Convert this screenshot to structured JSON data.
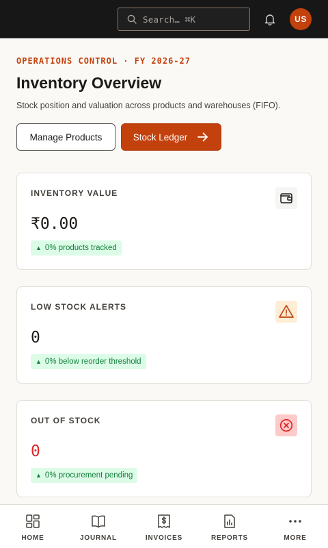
{
  "header": {
    "search_placeholder": "Search… ⌘K",
    "avatar_initials": "US"
  },
  "page": {
    "eyebrow": "OPERATIONS CONTROL · FY 2026-27",
    "title": "Inventory Overview",
    "subtitle": "Stock position and valuation across products and warehouses (FIFO)."
  },
  "actions": {
    "manage_label": "Manage Products",
    "ledger_label": "Stock Ledger"
  },
  "cards": [
    {
      "label": "INVENTORY VALUE",
      "value": "₹0.00",
      "badge": "0% products tracked",
      "icon": "wallet-icon"
    },
    {
      "label": "LOW STOCK ALERTS",
      "value": "0",
      "badge": "0% below reorder threshold",
      "icon": "warning-triangle-icon"
    },
    {
      "label": "OUT OF STOCK",
      "value": "0",
      "badge": "0% procurement pending",
      "icon": "x-circle-icon"
    }
  ],
  "nav": {
    "items": [
      {
        "label": "HOME",
        "icon": "grid-icon"
      },
      {
        "label": "JOURNAL",
        "icon": "book-icon"
      },
      {
        "label": "INVOICES",
        "icon": "receipt-icon"
      },
      {
        "label": "REPORTS",
        "icon": "report-icon"
      },
      {
        "label": "MORE",
        "icon": "more-icon"
      }
    ]
  },
  "colors": {
    "accent": "#c2410c",
    "topbar": "#171717",
    "positive_bg": "#dcfce7",
    "positive_fg": "#15803d",
    "danger": "#dc2626"
  }
}
